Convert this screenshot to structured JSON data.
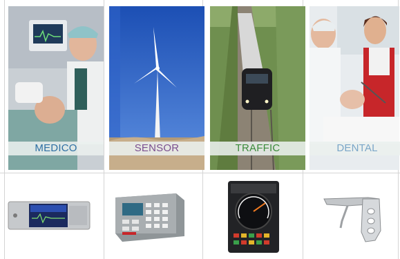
{
  "categories": [
    {
      "label": "MEDICO",
      "color": "#2e6fa3"
    },
    {
      "label": "SENSOR",
      "color": "#7b4f8f"
    },
    {
      "label": "TRAFFIC",
      "color": "#3a8a3a"
    },
    {
      "label": "DENTAL",
      "color": "#7aa6c8"
    }
  ],
  "devices": [
    {
      "name": "medical-monitor-device"
    },
    {
      "name": "sensor-control-panel-device"
    },
    {
      "name": "traffic-display-device"
    },
    {
      "name": "dental-handpiece-device"
    }
  ]
}
